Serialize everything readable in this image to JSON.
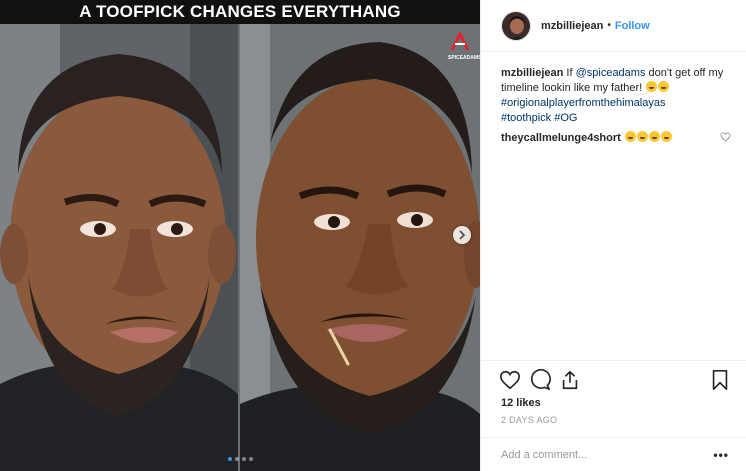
{
  "media": {
    "banner_text": "A TOOFPICK CHANGES EVERYTHANG",
    "watermark_text": "SPICEADAMS",
    "carousel": {
      "count": 4,
      "active_index": 0
    }
  },
  "header": {
    "username": "mzbilliejean",
    "separator": "•",
    "follow_label": "Follow"
  },
  "caption": {
    "username": "mzbilliejean",
    "text_1": "If ",
    "mention": "@spiceadams",
    "text_2": " don't get off my timeline lookin like my father! ",
    "emojis_1": [
      "weary-face-emoji",
      "tears-of-joy-emoji"
    ],
    "hashtag_1": "#origionalplayerfromthehimalayas",
    "hashtag_2": "#toothpick",
    "hashtag_3": "#OG"
  },
  "comments": [
    {
      "username": "theycallmelunge4short",
      "emojis": [
        "tears-of-joy-emoji",
        "tears-of-joy-emoji",
        "tears-of-joy-emoji",
        "tears-of-joy-emoji"
      ]
    }
  ],
  "actions": {
    "likes": "12 likes",
    "timestamp": "2 DAYS AGO"
  },
  "add_comment": {
    "placeholder": "Add a comment...",
    "more_label": "•••"
  },
  "colors": {
    "accent": "#3897f0",
    "link": "#003569",
    "text": "#262626",
    "muted": "#999999"
  }
}
